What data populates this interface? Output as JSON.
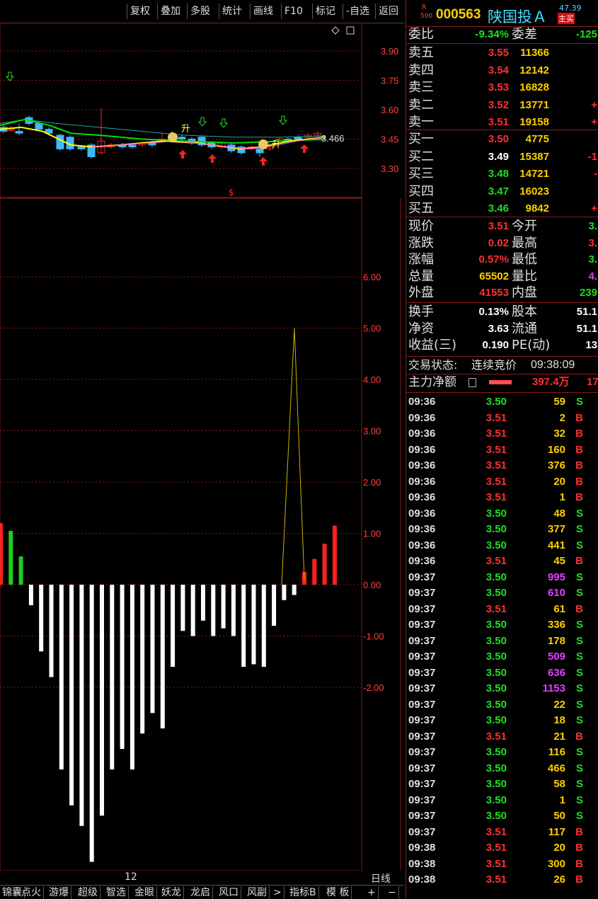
{
  "toolbar": {
    "buttons": [
      "复权",
      "叠加",
      "多股",
      "统计",
      "画线",
      "F10",
      "标记",
      "-自选",
      "返回"
    ]
  },
  "chart": {
    "kline_price_labels": [
      "3.90",
      "3.75",
      "3.60",
      "3.45",
      "3.30"
    ],
    "last_price_tag": "3.466",
    "signal_labels": [
      "升",
      "升"
    ],
    "marker_s": "$",
    "indicator_labels": [
      "6.00",
      "5.00",
      "4.00",
      "3.00",
      "2.00",
      "1.00",
      "0.00",
      "-1.00",
      "-2.00"
    ],
    "indicator_bars": [
      1.2,
      1.05,
      0.55,
      -0.4,
      -1.3,
      -1.8,
      -3.6,
      -4.3,
      -4.7,
      -5.4,
      -4.5,
      -3.6,
      -3.2,
      -3.6,
      -2.9,
      -2.5,
      -2.8,
      -1.6,
      -0.9,
      -1.0,
      -0.7,
      -1.0,
      -0.85,
      -1.0,
      -1.6,
      -1.55,
      -1.6,
      -0.8,
      -0.3,
      -0.2,
      0.25,
      0.5,
      0.8,
      1.15
    ],
    "indicator_line_peak": 5.0,
    "date_label": "12",
    "period_label": "日线",
    "colors": {
      "up": "#ff2020",
      "down": "#ffffff",
      "green": "#22cc22",
      "grid": "#8a1a1a",
      "axis_text": "#ff4040",
      "ma_yellow": "#ffff00",
      "ma_green": "#00e000",
      "ma_cyan": "#2aa3a3"
    }
  },
  "bottom_tabs": [
    "锦囊",
    "点火",
    "游爆",
    "超级",
    "智选",
    "金眼",
    "妖龙",
    "龙启",
    "风口",
    "风副",
    ">",
    "指标B",
    "模 板",
    "+",
    "−"
  ],
  "stock": {
    "badge_top": "R",
    "badge_bottom": "500",
    "code": "000563",
    "name": "陕国投Ａ",
    "top_small": "47.39",
    "tag": "主买"
  },
  "ratio": {
    "label": "委比",
    "value": "-9.34%",
    "diff_label": "委差",
    "diff_value": "-125"
  },
  "sell": [
    {
      "label": "卖五",
      "price": "3.55",
      "vol": "11366",
      "extra": ""
    },
    {
      "label": "卖四",
      "price": "3.54",
      "vol": "12142",
      "extra": ""
    },
    {
      "label": "卖三",
      "price": "3.53",
      "vol": "16828",
      "extra": ""
    },
    {
      "label": "卖二",
      "price": "3.52",
      "vol": "13771",
      "extra": "+"
    },
    {
      "label": "卖一",
      "price": "3.51",
      "vol": "19158",
      "extra": "+"
    }
  ],
  "buy": [
    {
      "label": "买一",
      "price": "3.50",
      "vol": "4775",
      "extra": ""
    },
    {
      "label": "买二",
      "price": "3.49",
      "vol": "15387",
      "extra": "-1"
    },
    {
      "label": "买三",
      "price": "3.48",
      "vol": "14721",
      "extra": "-"
    },
    {
      "label": "买四",
      "price": "3.47",
      "vol": "16023",
      "extra": ""
    },
    {
      "label": "买五",
      "price": "3.46",
      "vol": "9842",
      "extra": "+"
    }
  ],
  "quote": [
    {
      "l1": "现价",
      "v1": "3.51",
      "l2": "今开",
      "v2": "3."
    },
    {
      "l1": "涨跌",
      "v1": "0.02",
      "l2": "最高",
      "v2": "3."
    },
    {
      "l1": "涨幅",
      "v1": "0.57%",
      "l2": "最低",
      "v2": "3."
    },
    {
      "l1": "总量",
      "v1": "65502",
      "l2": "量比",
      "v2": "4."
    },
    {
      "l1": "外盘",
      "v1": "41553",
      "l2": "内盘",
      "v2": "239"
    }
  ],
  "quote2": [
    {
      "l1": "换手",
      "v1": "0.13%",
      "l2": "股本",
      "v2": "51.1"
    },
    {
      "l1": "净资",
      "v1": "3.63",
      "l2": "流通",
      "v2": "51.1"
    },
    {
      "l1": "收益(三)",
      "v1": "0.190",
      "l2": "PE(动)",
      "v2": "13"
    }
  ],
  "status": {
    "label": "交易状态:",
    "value": "连续竞价",
    "time": "09:38:09"
  },
  "main_force": {
    "label": "主力净额",
    "value": "397.4万",
    "extra": "17"
  },
  "ticks": [
    [
      "09:36",
      "3.50",
      "59",
      "S"
    ],
    [
      "09:36",
      "3.51",
      "2",
      "B"
    ],
    [
      "09:36",
      "3.51",
      "32",
      "B"
    ],
    [
      "09:36",
      "3.51",
      "160",
      "B"
    ],
    [
      "09:36",
      "3.51",
      "376",
      "B"
    ],
    [
      "09:36",
      "3.51",
      "20",
      "B"
    ],
    [
      "09:36",
      "3.51",
      "1",
      "B"
    ],
    [
      "09:36",
      "3.50",
      "48",
      "S"
    ],
    [
      "09:36",
      "3.50",
      "377",
      "S"
    ],
    [
      "09:36",
      "3.50",
      "441",
      "S"
    ],
    [
      "09:36",
      "3.51",
      "45",
      "B"
    ],
    [
      "09:37",
      "3.50",
      "995",
      "S"
    ],
    [
      "09:37",
      "3.50",
      "610",
      "S"
    ],
    [
      "09:37",
      "3.51",
      "61",
      "B"
    ],
    [
      "09:37",
      "3.50",
      "336",
      "S"
    ],
    [
      "09:37",
      "3.50",
      "178",
      "S"
    ],
    [
      "09:37",
      "3.50",
      "509",
      "S"
    ],
    [
      "09:37",
      "3.50",
      "636",
      "S"
    ],
    [
      "09:37",
      "3.50",
      "1153",
      "S"
    ],
    [
      "09:37",
      "3.50",
      "22",
      "S"
    ],
    [
      "09:37",
      "3.50",
      "18",
      "S"
    ],
    [
      "09:37",
      "3.51",
      "21",
      "B"
    ],
    [
      "09:37",
      "3.50",
      "116",
      "S"
    ],
    [
      "09:37",
      "3.50",
      "466",
      "S"
    ],
    [
      "09:37",
      "3.50",
      "58",
      "S"
    ],
    [
      "09:37",
      "3.50",
      "1",
      "S"
    ],
    [
      "09:37",
      "3.50",
      "50",
      "S"
    ],
    [
      "09:37",
      "3.51",
      "117",
      "B"
    ],
    [
      "09:38",
      "3.51",
      "20",
      "B"
    ],
    [
      "09:38",
      "3.51",
      "300",
      "B"
    ],
    [
      "09:38",
      "3.51",
      "26",
      "B"
    ]
  ]
}
